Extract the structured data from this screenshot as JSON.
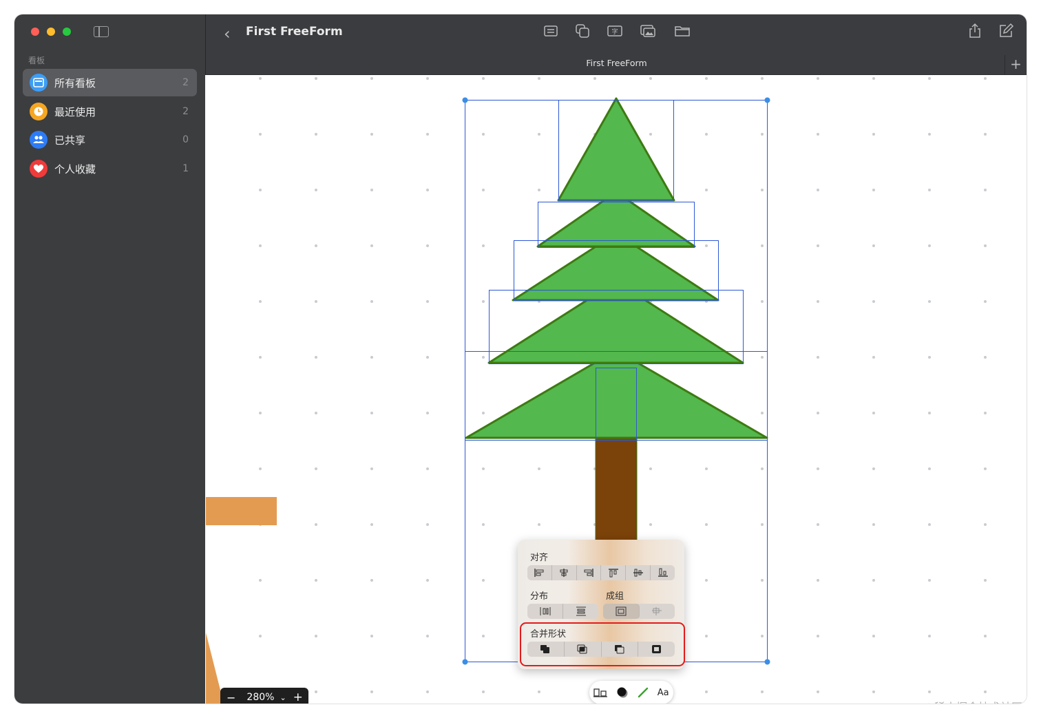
{
  "sidebar": {
    "section_label": "看板",
    "items": [
      {
        "label": "所有看板",
        "count": "2",
        "icon": "boards-icon",
        "color": "#3c9df5"
      },
      {
        "label": "最近使用",
        "count": "2",
        "icon": "clock-icon",
        "color": "#f5a623"
      },
      {
        "label": "已共享",
        "count": "0",
        "icon": "people-icon",
        "color": "#2d7cf6"
      },
      {
        "label": "个人收藏",
        "count": "1",
        "icon": "heart-icon",
        "color": "#ef3b3b"
      }
    ]
  },
  "header": {
    "title": "First FreeForm",
    "tab_title": "First FreeForm",
    "toolbar_icons": [
      "sticky-note-icon",
      "shape-icon",
      "text-box-icon",
      "media-icon",
      "folder-icon"
    ],
    "right_icons": [
      "share-icon",
      "new-board-icon"
    ]
  },
  "popover": {
    "align_label": "对齐",
    "distribute_label": "分布",
    "group_label": "成组",
    "combine_label": "合并形状"
  },
  "zoom": {
    "minus": "−",
    "value": "280%",
    "plus": "+"
  },
  "bottom_toolbar": {
    "text_label": "Aa"
  },
  "watermark": "@稀土掘金技术社区",
  "colors": {
    "tree_fill": "#53b84e",
    "tree_stroke": "#3d7a12",
    "trunk": "#7b4209",
    "selection": "#2b57d6",
    "highlight": "#e31a1a"
  }
}
